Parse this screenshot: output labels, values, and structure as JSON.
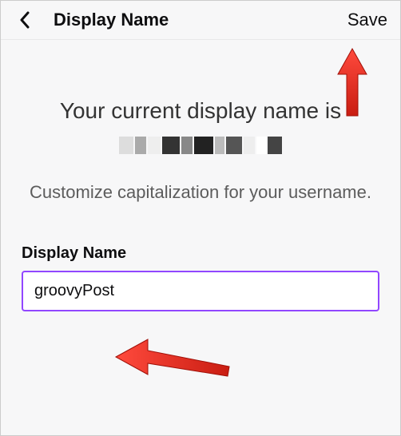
{
  "header": {
    "title": "Display Name",
    "save_label": "Save"
  },
  "content": {
    "heading": "Your current display name is",
    "subheading": "Customize capitalization for your username."
  },
  "field": {
    "label": "Display Name",
    "value": "groovyPost"
  }
}
